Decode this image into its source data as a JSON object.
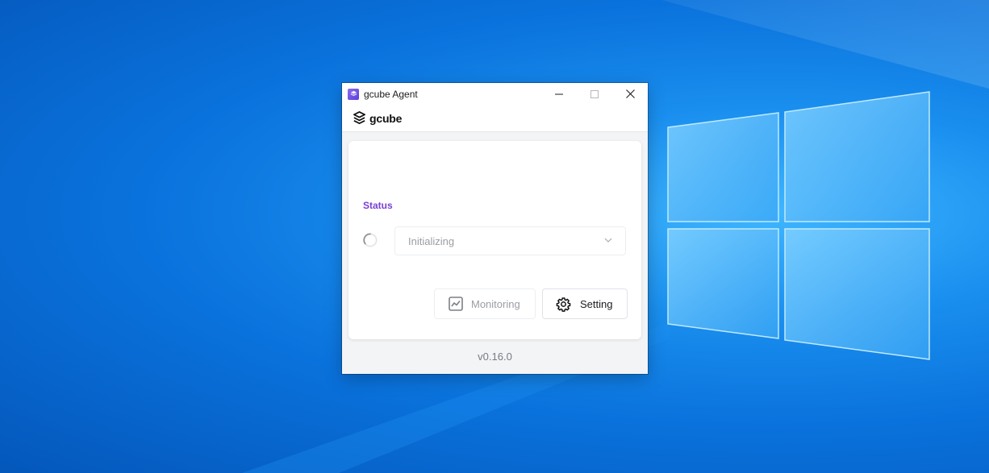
{
  "window": {
    "title": "gcube Agent",
    "icon": "gcube-app-icon",
    "controls": [
      "minimize-icon",
      "maximize-icon",
      "close-icon"
    ]
  },
  "brand": {
    "name": "gcube",
    "icon": "gcube-logo-icon"
  },
  "status": {
    "label": "Status",
    "value": "Initializing",
    "indicator_icon": "loading-spinner-icon",
    "dropdown_icon": "chevron-down-icon"
  },
  "actions": {
    "monitoring_label": "Monitoring",
    "monitoring_icon": "chart-icon",
    "monitoring_enabled": false,
    "setting_label": "Setting",
    "setting_icon": "gear-icon"
  },
  "footer": {
    "version": "v0.16.0"
  },
  "colors": {
    "accent": "#7a3fd6",
    "desktop": "#0a72dc",
    "window_bg": "#f2f4f6"
  }
}
